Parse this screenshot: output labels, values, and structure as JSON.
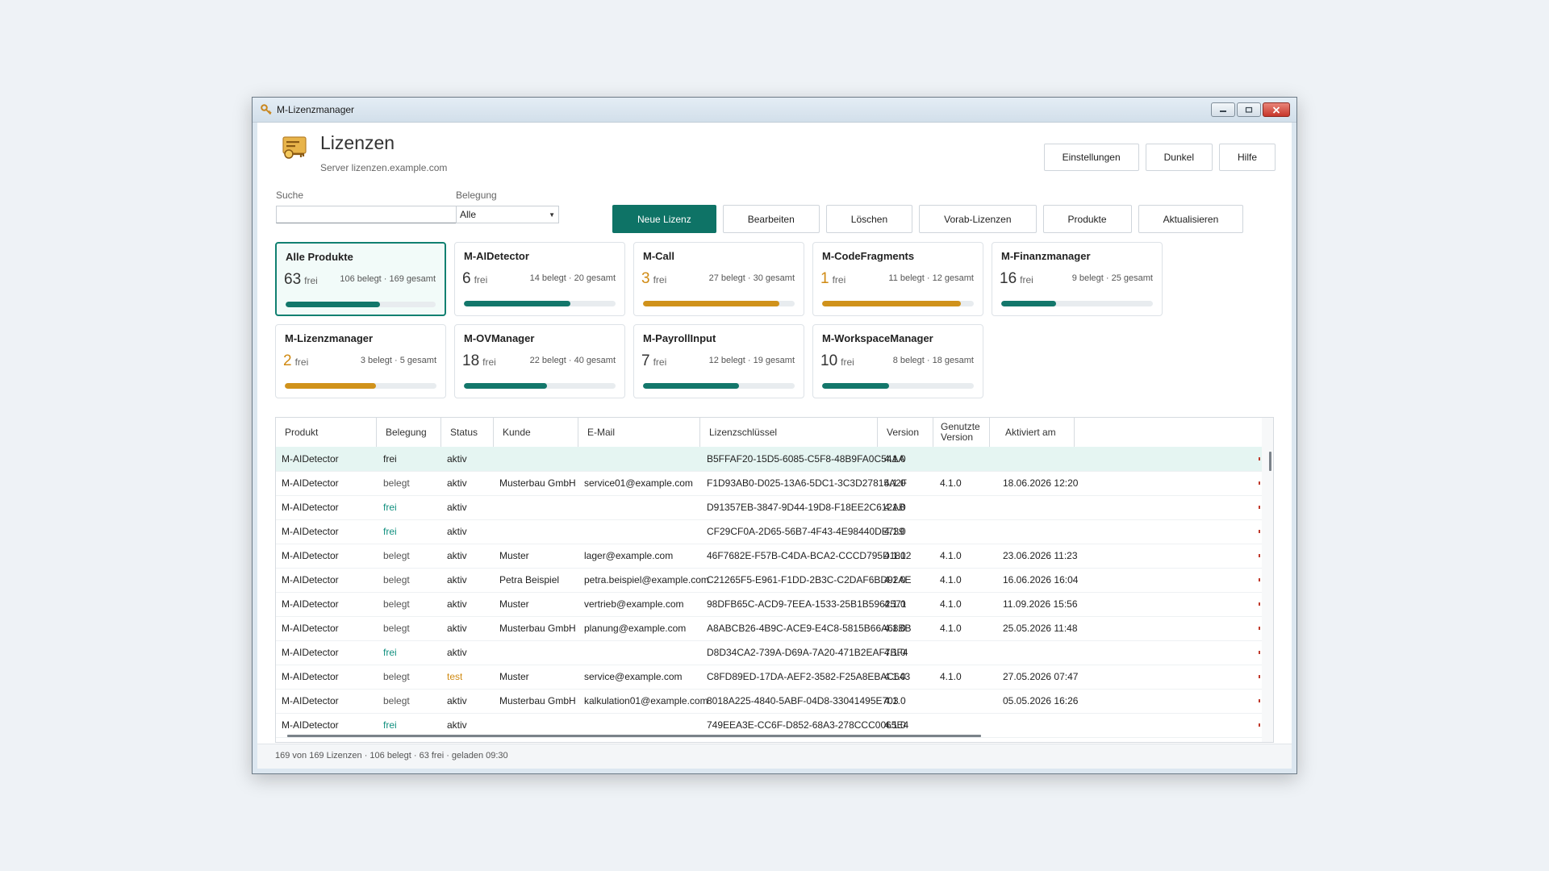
{
  "window": {
    "title": "M-Lizenzmanager"
  },
  "header": {
    "title": "Lizenzen",
    "server": "Server lizenzen.example.com",
    "actions": [
      "Einstellungen",
      "Dunkel",
      "Hilfe"
    ]
  },
  "filters": {
    "search_label": "Suche",
    "search_value": "",
    "belegung_label": "Belegung",
    "belegung_value": "Alle"
  },
  "toolbar": [
    "Neue Lizenz",
    "Bearbeiten",
    "Löschen",
    "Vorab-Lizenzen",
    "Produkte",
    "Aktualisieren"
  ],
  "colors": {
    "accent": "#0e7366",
    "ok_bar": "#13776b",
    "warn_bar": "#d0921b",
    "warn_text": "#d08a12",
    "free_text": "#11907f"
  },
  "free_unit": "frei",
  "tiles": [
    {
      "name": "Alle Produkte",
      "free": "63",
      "stats": "106 belegt · 169 gesamt",
      "fill": 0.627,
      "status": "ok",
      "selected": true
    },
    {
      "name": "M-AIDetector",
      "free": "6",
      "stats": "14 belegt · 20 gesamt",
      "fill": 0.7,
      "status": "ok"
    },
    {
      "name": "M-Call",
      "free": "3",
      "stats": "27 belegt · 30 gesamt",
      "fill": 0.9,
      "status": "warn"
    },
    {
      "name": "M-CodeFragments",
      "free": "1",
      "stats": "11 belegt · 12 gesamt",
      "fill": 0.917,
      "status": "warn"
    },
    {
      "name": "M-Finanzmanager",
      "free": "16",
      "stats": "9 belegt · 25 gesamt",
      "fill": 0.36,
      "status": "ok"
    },
    {
      "name": "M-Lizenzmanager",
      "free": "2",
      "stats": "3 belegt · 5 gesamt",
      "fill": 0.6,
      "status": "warn"
    },
    {
      "name": "M-OVManager",
      "free": "18",
      "stats": "22 belegt · 40 gesamt",
      "fill": 0.55,
      "status": "ok"
    },
    {
      "name": "M-PayrollInput",
      "free": "7",
      "stats": "12 belegt · 19 gesamt",
      "fill": 0.632,
      "status": "ok"
    },
    {
      "name": "M-WorkspaceManager",
      "free": "10",
      "stats": "8 belegt · 18 gesamt",
      "fill": 0.444,
      "status": "ok"
    }
  ],
  "table": {
    "columns": [
      "Produkt",
      "Belegung",
      "Status",
      "Kunde",
      "E-Mail",
      "Lizenzschlüssel",
      "Version",
      "Genutzte Version",
      "Aktiviert am"
    ],
    "rows": [
      [
        "M-AIDetector",
        "frei",
        "aktiv",
        "",
        "",
        "B5FFAF20-15D5-6085-C5F8-48B9FA0C54AA",
        "4.1.0",
        "",
        ""
      ],
      [
        "M-AIDetector",
        "belegt",
        "aktiv",
        "Musterbau GmbH",
        "service01@example.com",
        "F1D93AB0-D025-13A6-5DC1-3C3D27815A2F",
        "4.1.0",
        "4.1.0",
        "18.06.2026 12:20"
      ],
      [
        "M-AIDetector",
        "frei",
        "aktiv",
        "",
        "",
        "D91357EB-3847-9D44-19D8-F18EE2C612AB",
        "4.1.0",
        "",
        ""
      ],
      [
        "M-AIDetector",
        "frei",
        "aktiv",
        "",
        "",
        "CF29CF0A-2D65-56B7-4F43-4E98440DE739",
        "4.1.0",
        "",
        ""
      ],
      [
        "M-AIDetector",
        "belegt",
        "aktiv",
        "Muster",
        "lager@example.com",
        "46F7682E-F57B-C4DA-BCA2-CCCD795D1812",
        "4.1.0",
        "4.1.0",
        "23.06.2026 11:23"
      ],
      [
        "M-AIDetector",
        "belegt",
        "aktiv",
        "Petra Beispiel",
        "petra.beispiel@example.com",
        "C21265F5-E961-F1DD-2B3C-C2DAF6BD92AE",
        "4.1.0",
        "4.1.0",
        "16.06.2026 16:04"
      ],
      [
        "M-AIDetector",
        "belegt",
        "aktiv",
        "Muster",
        "vertrieb@example.com",
        "98DFB65C-ACD9-7EEA-1533-25B1B5962571",
        "4.1.0",
        "4.1.0",
        "11.09.2026 15:56"
      ],
      [
        "M-AIDetector",
        "belegt",
        "aktiv",
        "Musterbau GmbH",
        "planung@example.com",
        "A8ABCB26-4B9C-ACE9-E4C8-5815B66A68BB",
        "4.1.0",
        "4.1.0",
        "25.05.2026 11:48"
      ],
      [
        "M-AIDetector",
        "frei",
        "aktiv",
        "",
        "",
        "D8D34CA2-739A-D69A-7A20-471B2EAF7BF4",
        "4.1.0",
        "",
        ""
      ],
      [
        "M-AIDetector",
        "belegt",
        "test",
        "Muster",
        "service@example.com",
        "C8FD89ED-17DA-AEF2-3582-F25A8EBAC643",
        "4.1.0",
        "4.1.0",
        "27.05.2026 07:47"
      ],
      [
        "M-AIDetector",
        "belegt",
        "aktiv",
        "Musterbau GmbH",
        "kalkulation01@example.com",
        "8018A225-4840-5ABF-04D8-33041495E703",
        "4.1.0",
        "",
        "05.05.2026 16:26"
      ],
      [
        "M-AIDetector",
        "frei",
        "aktiv",
        "",
        "",
        "749EEA3E-CC6F-D852-68A3-278CCC0065E4",
        "4.1.0",
        "",
        ""
      ]
    ]
  },
  "status_bar": "169 von 169 Lizenzen · 106 belegt · 63 frei · geladen 09:30"
}
